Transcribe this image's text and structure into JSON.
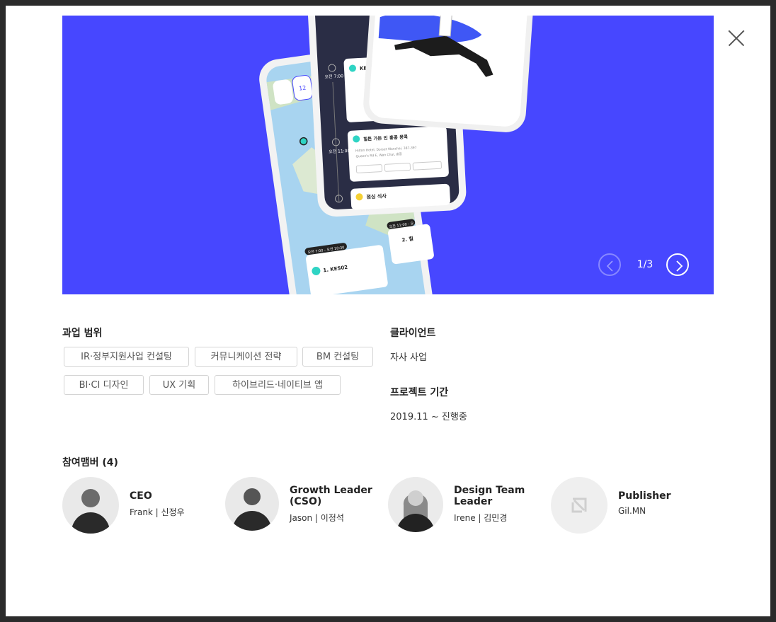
{
  "hero": {
    "counter": "1/3"
  },
  "scope": {
    "title": "과업 범위",
    "tags": [
      "IR·정부지원사업 컨설팅",
      "커뮤니케이션 전략",
      "BM 컨설팅",
      "BI·CI 디자인",
      "UX 기획",
      "하이브리드·네이티브 앱"
    ]
  },
  "client": {
    "title": "클라이언트",
    "value": "자사 사업"
  },
  "period": {
    "title": "프로젝트 기간",
    "value": "2019.11 ~ 진행중"
  },
  "members": {
    "title": "참여맴버 (4)",
    "items": [
      {
        "role": "CEO",
        "name": "Frank | 신정우",
        "icon": "person-photo"
      },
      {
        "role": "Growth Leader (CSO)",
        "name": "Jason | 이정석",
        "icon": "person-photo"
      },
      {
        "role": "Design Team Leader",
        "name": "Irene | 김민경",
        "icon": "person-photo"
      },
      {
        "role": "Publisher",
        "name": "Gil.MN",
        "icon": "placeholder-logo-icon"
      }
    ]
  },
  "phone_screen": {
    "map_card_title": "1. KES02",
    "map_card_title_2": "2. 힐",
    "timeline_time_1": "오전 7:00",
    "timeline_time_2": "오전 11:00",
    "card_1_title": "KES",
    "card_2_title": "힐튼 가든 인 홍콩 몽콕",
    "card_2_address": "Hilton Hotel, Dorset Wanchai, 387-397",
    "card_2_address_2": "Queen's Rd E, Wan Chai, 홍콩",
    "card_3_title": "점심 식사",
    "map_pill_1": "오전 7:00 - 오전 10:30",
    "map_pill_2": "오전 11:00 - 오",
    "date_badge": "12"
  },
  "colors": {
    "hero_bg": "#4747ff",
    "accent_teal": "#2fd4c4"
  }
}
